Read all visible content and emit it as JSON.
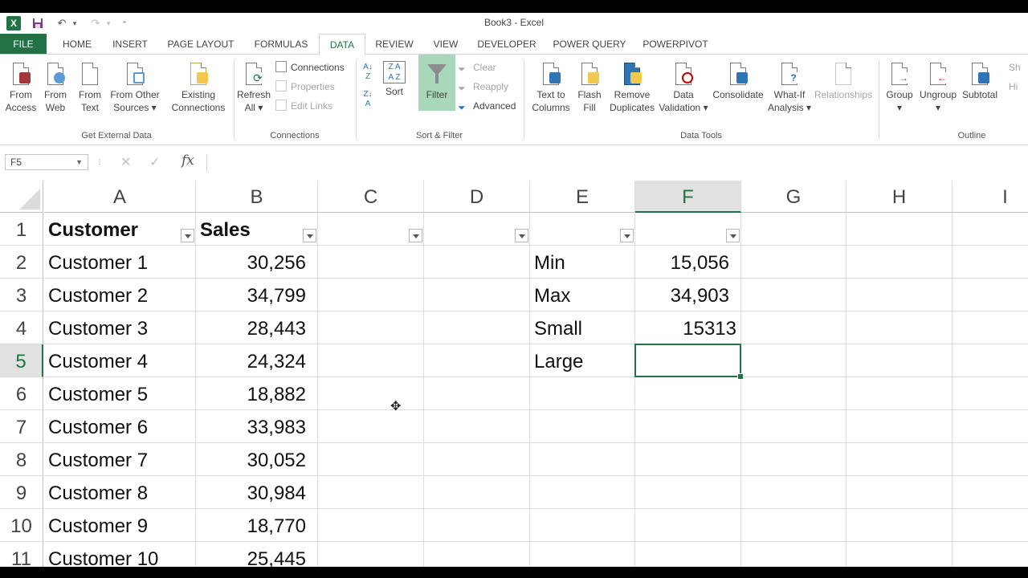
{
  "window": {
    "title": "Book3 - Excel"
  },
  "tabs": [
    "FILE",
    "HOME",
    "INSERT",
    "PAGE LAYOUT",
    "FORMULAS",
    "DATA",
    "REVIEW",
    "VIEW",
    "DEVELOPER",
    "POWER QUERY",
    "POWERPIVOT"
  ],
  "active_tab": "DATA",
  "ribbon": {
    "get_external_data": {
      "label": "Get External Data",
      "from_access": [
        "From",
        "Access"
      ],
      "from_web": [
        "From",
        "Web"
      ],
      "from_text": [
        "From",
        "Text"
      ],
      "from_other": [
        "From Other",
        "Sources"
      ]
    },
    "existing_connections": [
      "Existing",
      "Connections"
    ],
    "connections": {
      "label": "Connections",
      "refresh": [
        "Refresh",
        "All"
      ],
      "connections": "Connections",
      "properties": "Properties",
      "edit_links": "Edit Links"
    },
    "sort_filter": {
      "label": "Sort & Filter",
      "sort": "Sort",
      "filter": "Filter",
      "clear": "Clear",
      "reapply": "Reapply",
      "advanced": "Advanced"
    },
    "data_tools": {
      "label": "Data Tools",
      "text_to_columns": [
        "Text to",
        "Columns"
      ],
      "flash_fill": [
        "Flash",
        "Fill"
      ],
      "remove_duplicates": [
        "Remove",
        "Duplicates"
      ],
      "data_validation": [
        "Data",
        "Validation"
      ],
      "consolidate": "Consolidate",
      "what_if": [
        "What-If",
        "Analysis"
      ],
      "relationships": "Relationships"
    },
    "outline": {
      "label": "Outline",
      "group": "Group",
      "ungroup": "Ungroup",
      "subtotal": "Subtotal",
      "show": "Sh",
      "hide": "Hi"
    }
  },
  "formula_bar": {
    "name_box": "F5",
    "fx": "fx",
    "value": ""
  },
  "columns": [
    "A",
    "B",
    "C",
    "D",
    "E",
    "F",
    "G",
    "H",
    "I"
  ],
  "selected_column": "F",
  "rows": [
    "1",
    "2",
    "3",
    "4",
    "5",
    "6",
    "7",
    "8",
    "9",
    "10",
    "11"
  ],
  "selected_row": "5",
  "sheet": {
    "headers": {
      "A": "Customer",
      "B": "Sales"
    },
    "data": [
      {
        "customer": "Customer 1",
        "sales": "30,256"
      },
      {
        "customer": "Customer 2",
        "sales": "34,799"
      },
      {
        "customer": "Customer 3",
        "sales": "28,443"
      },
      {
        "customer": "Customer 4",
        "sales": "24,324"
      },
      {
        "customer": "Customer 5",
        "sales": "18,882"
      },
      {
        "customer": "Customer 6",
        "sales": "33,983"
      },
      {
        "customer": "Customer 7",
        "sales": "30,052"
      },
      {
        "customer": "Customer 8",
        "sales": "30,984"
      },
      {
        "customer": "Customer 9",
        "sales": "18,770"
      },
      {
        "customer": "Customer 10",
        "sales": "25,445"
      }
    ],
    "stats": [
      {
        "label": "Min",
        "value": "15,056"
      },
      {
        "label": "Max",
        "value": "34,903"
      },
      {
        "label": "Small",
        "value": "15313"
      },
      {
        "label": "Large",
        "value": ""
      }
    ]
  },
  "colors": {
    "accent": "#217346",
    "filter_active": "#a8d8b9"
  }
}
